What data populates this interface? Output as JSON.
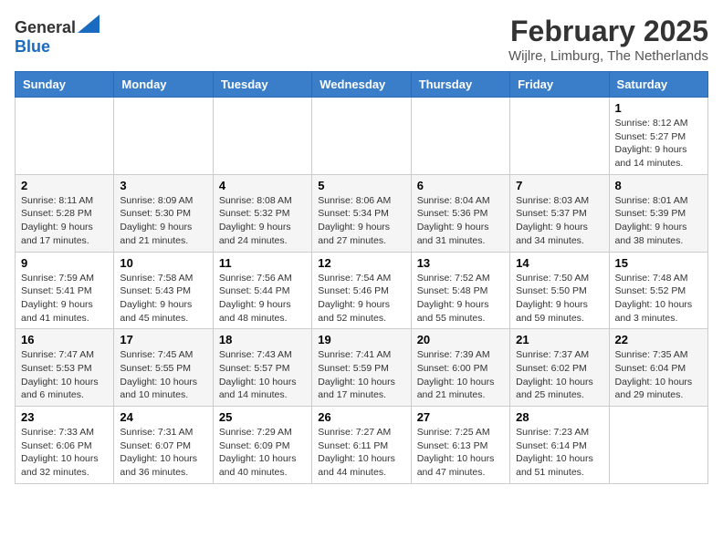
{
  "logo": {
    "general": "General",
    "blue": "Blue"
  },
  "header": {
    "month": "February 2025",
    "location": "Wijlre, Limburg, The Netherlands"
  },
  "weekdays": [
    "Sunday",
    "Monday",
    "Tuesday",
    "Wednesday",
    "Thursday",
    "Friday",
    "Saturday"
  ],
  "weeks": [
    [
      null,
      null,
      null,
      null,
      null,
      null,
      {
        "day": "1",
        "sunrise": "8:12 AM",
        "sunset": "5:27 PM",
        "daylight": "9 hours and 14 minutes."
      }
    ],
    [
      {
        "day": "2",
        "sunrise": "8:11 AM",
        "sunset": "5:28 PM",
        "daylight": "9 hours and 17 minutes."
      },
      {
        "day": "3",
        "sunrise": "8:09 AM",
        "sunset": "5:30 PM",
        "daylight": "9 hours and 21 minutes."
      },
      {
        "day": "4",
        "sunrise": "8:08 AM",
        "sunset": "5:32 PM",
        "daylight": "9 hours and 24 minutes."
      },
      {
        "day": "5",
        "sunrise": "8:06 AM",
        "sunset": "5:34 PM",
        "daylight": "9 hours and 27 minutes."
      },
      {
        "day": "6",
        "sunrise": "8:04 AM",
        "sunset": "5:36 PM",
        "daylight": "9 hours and 31 minutes."
      },
      {
        "day": "7",
        "sunrise": "8:03 AM",
        "sunset": "5:37 PM",
        "daylight": "9 hours and 34 minutes."
      },
      {
        "day": "8",
        "sunrise": "8:01 AM",
        "sunset": "5:39 PM",
        "daylight": "9 hours and 38 minutes."
      }
    ],
    [
      {
        "day": "9",
        "sunrise": "7:59 AM",
        "sunset": "5:41 PM",
        "daylight": "9 hours and 41 minutes."
      },
      {
        "day": "10",
        "sunrise": "7:58 AM",
        "sunset": "5:43 PM",
        "daylight": "9 hours and 45 minutes."
      },
      {
        "day": "11",
        "sunrise": "7:56 AM",
        "sunset": "5:44 PM",
        "daylight": "9 hours and 48 minutes."
      },
      {
        "day": "12",
        "sunrise": "7:54 AM",
        "sunset": "5:46 PM",
        "daylight": "9 hours and 52 minutes."
      },
      {
        "day": "13",
        "sunrise": "7:52 AM",
        "sunset": "5:48 PM",
        "daylight": "9 hours and 55 minutes."
      },
      {
        "day": "14",
        "sunrise": "7:50 AM",
        "sunset": "5:50 PM",
        "daylight": "9 hours and 59 minutes."
      },
      {
        "day": "15",
        "sunrise": "7:48 AM",
        "sunset": "5:52 PM",
        "daylight": "10 hours and 3 minutes."
      }
    ],
    [
      {
        "day": "16",
        "sunrise": "7:47 AM",
        "sunset": "5:53 PM",
        "daylight": "10 hours and 6 minutes."
      },
      {
        "day": "17",
        "sunrise": "7:45 AM",
        "sunset": "5:55 PM",
        "daylight": "10 hours and 10 minutes."
      },
      {
        "day": "18",
        "sunrise": "7:43 AM",
        "sunset": "5:57 PM",
        "daylight": "10 hours and 14 minutes."
      },
      {
        "day": "19",
        "sunrise": "7:41 AM",
        "sunset": "5:59 PM",
        "daylight": "10 hours and 17 minutes."
      },
      {
        "day": "20",
        "sunrise": "7:39 AM",
        "sunset": "6:00 PM",
        "daylight": "10 hours and 21 minutes."
      },
      {
        "day": "21",
        "sunrise": "7:37 AM",
        "sunset": "6:02 PM",
        "daylight": "10 hours and 25 minutes."
      },
      {
        "day": "22",
        "sunrise": "7:35 AM",
        "sunset": "6:04 PM",
        "daylight": "10 hours and 29 minutes."
      }
    ],
    [
      {
        "day": "23",
        "sunrise": "7:33 AM",
        "sunset": "6:06 PM",
        "daylight": "10 hours and 32 minutes."
      },
      {
        "day": "24",
        "sunrise": "7:31 AM",
        "sunset": "6:07 PM",
        "daylight": "10 hours and 36 minutes."
      },
      {
        "day": "25",
        "sunrise": "7:29 AM",
        "sunset": "6:09 PM",
        "daylight": "10 hours and 40 minutes."
      },
      {
        "day": "26",
        "sunrise": "7:27 AM",
        "sunset": "6:11 PM",
        "daylight": "10 hours and 44 minutes."
      },
      {
        "day": "27",
        "sunrise": "7:25 AM",
        "sunset": "6:13 PM",
        "daylight": "10 hours and 47 minutes."
      },
      {
        "day": "28",
        "sunrise": "7:23 AM",
        "sunset": "6:14 PM",
        "daylight": "10 hours and 51 minutes."
      },
      null
    ]
  ]
}
